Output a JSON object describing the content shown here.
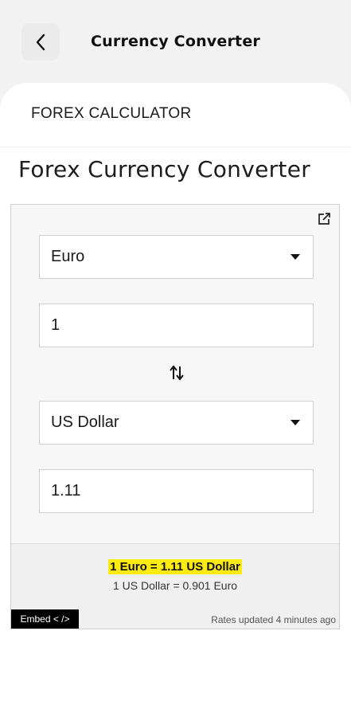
{
  "header": {
    "title": "Currency Converter",
    "back_icon": "chevron-left-icon"
  },
  "section": {
    "label": "FOREX CALCULATOR"
  },
  "converter": {
    "title": "Forex Currency Converter",
    "from_currency": "Euro",
    "amount": "1",
    "to_currency": "US Dollar",
    "result": "1.11",
    "rate_main": "1 Euro = 1.11 US Dollar",
    "rate_inverse": "1 US Dollar = 0.901 Euro",
    "embed_label": "Embed < />",
    "updated": "Rates updated 4 minutes ago",
    "highlight_color": "#ffeb10"
  }
}
